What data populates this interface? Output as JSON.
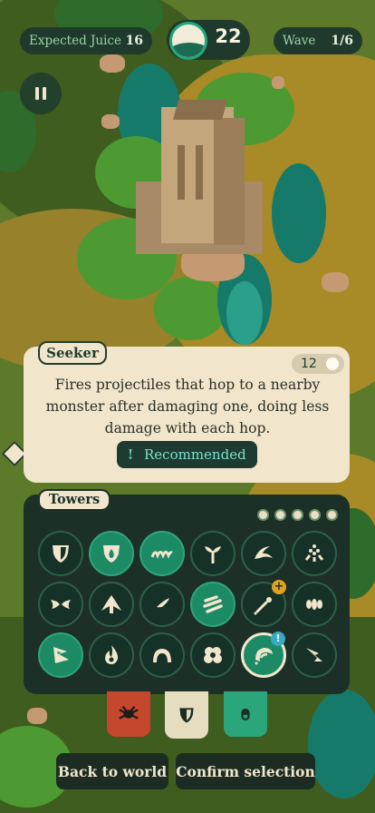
{
  "hud": {
    "juice_label": "Expected Juice",
    "juice_value": "16",
    "energy_value": "22",
    "wave_label": "Wave",
    "wave_value": "1/6",
    "pause_icon": "pause-icon"
  },
  "info": {
    "tower_name": "Seeker",
    "cost": "12",
    "description": "Fires projectiles that hop to a nearby monster after damaging one, doing less damage with each hop.",
    "recommended_icon": "!",
    "recommended_label": "Recommended"
  },
  "towers_panel": {
    "title": "Towers",
    "page_count": 5,
    "slots": [
      {
        "icon": "shield-icon"
      },
      {
        "icon": "flame-shield-icon"
      },
      {
        "icon": "wave-icon"
      },
      {
        "icon": "sprout-icon"
      },
      {
        "icon": "hook-icon"
      },
      {
        "icon": "spray-icon"
      },
      {
        "icon": "scissors-icon"
      },
      {
        "icon": "leaf-arch-icon"
      },
      {
        "icon": "petal-icon"
      },
      {
        "icon": "slashes-icon"
      },
      {
        "icon": "wand-icon",
        "badge": "+"
      },
      {
        "icon": "seeds-icon"
      },
      {
        "icon": "claw-icon"
      },
      {
        "icon": "flame-icon"
      },
      {
        "icon": "dome-icon"
      },
      {
        "icon": "cloud-icon"
      },
      {
        "icon": "seeker-hop-icon",
        "badge": "!"
      },
      {
        "icon": "arrow-burst-icon"
      }
    ]
  },
  "categories": [
    {
      "icon": "spider-icon",
      "color": "#c5472c"
    },
    {
      "icon": "shield-icon",
      "color": "#e6dcbf"
    },
    {
      "icon": "capsule-icon",
      "color": "#2aa67a"
    }
  ],
  "buttons": {
    "back": "Back to world",
    "confirm": "Confirm selection"
  },
  "colors": {
    "panel": "#1c3028",
    "card": "#f1e6cc",
    "accent": "#1d8a66"
  }
}
